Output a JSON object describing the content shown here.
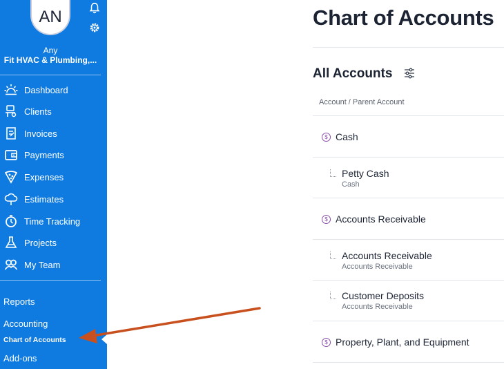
{
  "sidebar": {
    "avatar_initials": "AN",
    "user_first": "Any",
    "company": "Fit HVAC & Plumbing,...",
    "nav": [
      {
        "label": "Dashboard",
        "icon": "sun-icon"
      },
      {
        "label": "Clients",
        "icon": "clients-icon"
      },
      {
        "label": "Invoices",
        "icon": "invoice-icon"
      },
      {
        "label": "Payments",
        "icon": "wallet-icon"
      },
      {
        "label": "Expenses",
        "icon": "pizza-icon"
      },
      {
        "label": "Estimates",
        "icon": "cloud-icon"
      },
      {
        "label": "Time Tracking",
        "icon": "stopwatch-icon"
      },
      {
        "label": "Projects",
        "icon": "flask-icon"
      },
      {
        "label": "My Team",
        "icon": "team-icon"
      }
    ],
    "reports": "Reports",
    "accounting": "Accounting",
    "chart_of_accounts": "Chart of Accounts",
    "addons": "Add-ons"
  },
  "colors": {
    "sidebar": "#0f7be0",
    "badge": "#8a4fa8",
    "arrow": "#c8501e",
    "text": "#1c2333"
  },
  "main": {
    "title": "Chart of Accounts",
    "section": "All Accounts",
    "column_header": "Account / Parent Account",
    "rows": [
      {
        "type": "parent",
        "name": "Cash",
        "badge": "$"
      },
      {
        "type": "child",
        "name": "Petty Cash",
        "parent": "Cash"
      },
      {
        "type": "parent",
        "name": "Accounts Receivable",
        "badge": "$"
      },
      {
        "type": "child",
        "name": "Accounts Receivable",
        "parent": "Accounts Receivable"
      },
      {
        "type": "child",
        "name": "Customer Deposits",
        "parent": "Accounts Receivable"
      },
      {
        "type": "parent",
        "name": "Property, Plant, and Equipment",
        "badge": "$"
      }
    ]
  }
}
